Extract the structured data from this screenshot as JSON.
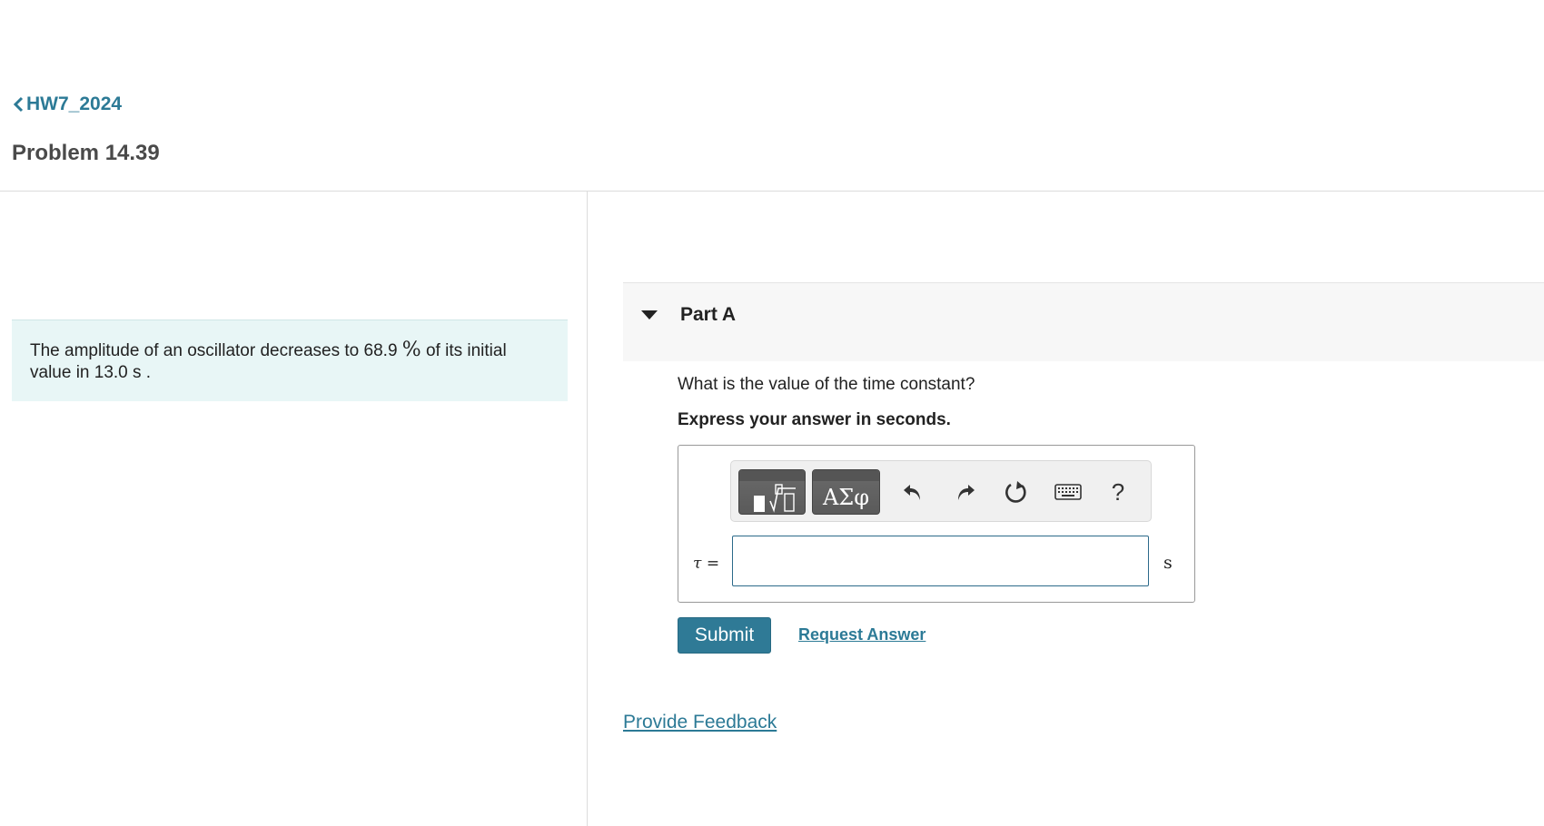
{
  "breadcrumb": {
    "back_label": "HW7_2024"
  },
  "page": {
    "title": "Problem 14.39"
  },
  "problem": {
    "text_before": "The amplitude of an oscillator decreases to 68.9 ",
    "percent_symbol": "%",
    "text_after": " of its initial value in 13.0  s ."
  },
  "part": {
    "title": "Part A",
    "question": "What is the value of the time constant?",
    "instruction": "Express your answer in seconds.",
    "toolbar": {
      "greek_label": "ΑΣφ",
      "help_label": "?",
      "icons": [
        "templates-icon",
        "greek-letters-icon",
        "undo-icon",
        "redo-icon",
        "reset-icon",
        "keyboard-icon",
        "help-icon"
      ]
    },
    "answer": {
      "variable_symbol": "τ",
      "equals": "=",
      "value": "",
      "unit": "s"
    },
    "submit_label": "Submit",
    "request_answer_label": "Request Answer"
  },
  "feedback_label": "Provide Feedback",
  "colors": {
    "link": "#2c7a96",
    "submit_bg": "#2f7a96",
    "problem_bg": "#e8f6f6",
    "part_header_bg": "#f7f7f7"
  }
}
